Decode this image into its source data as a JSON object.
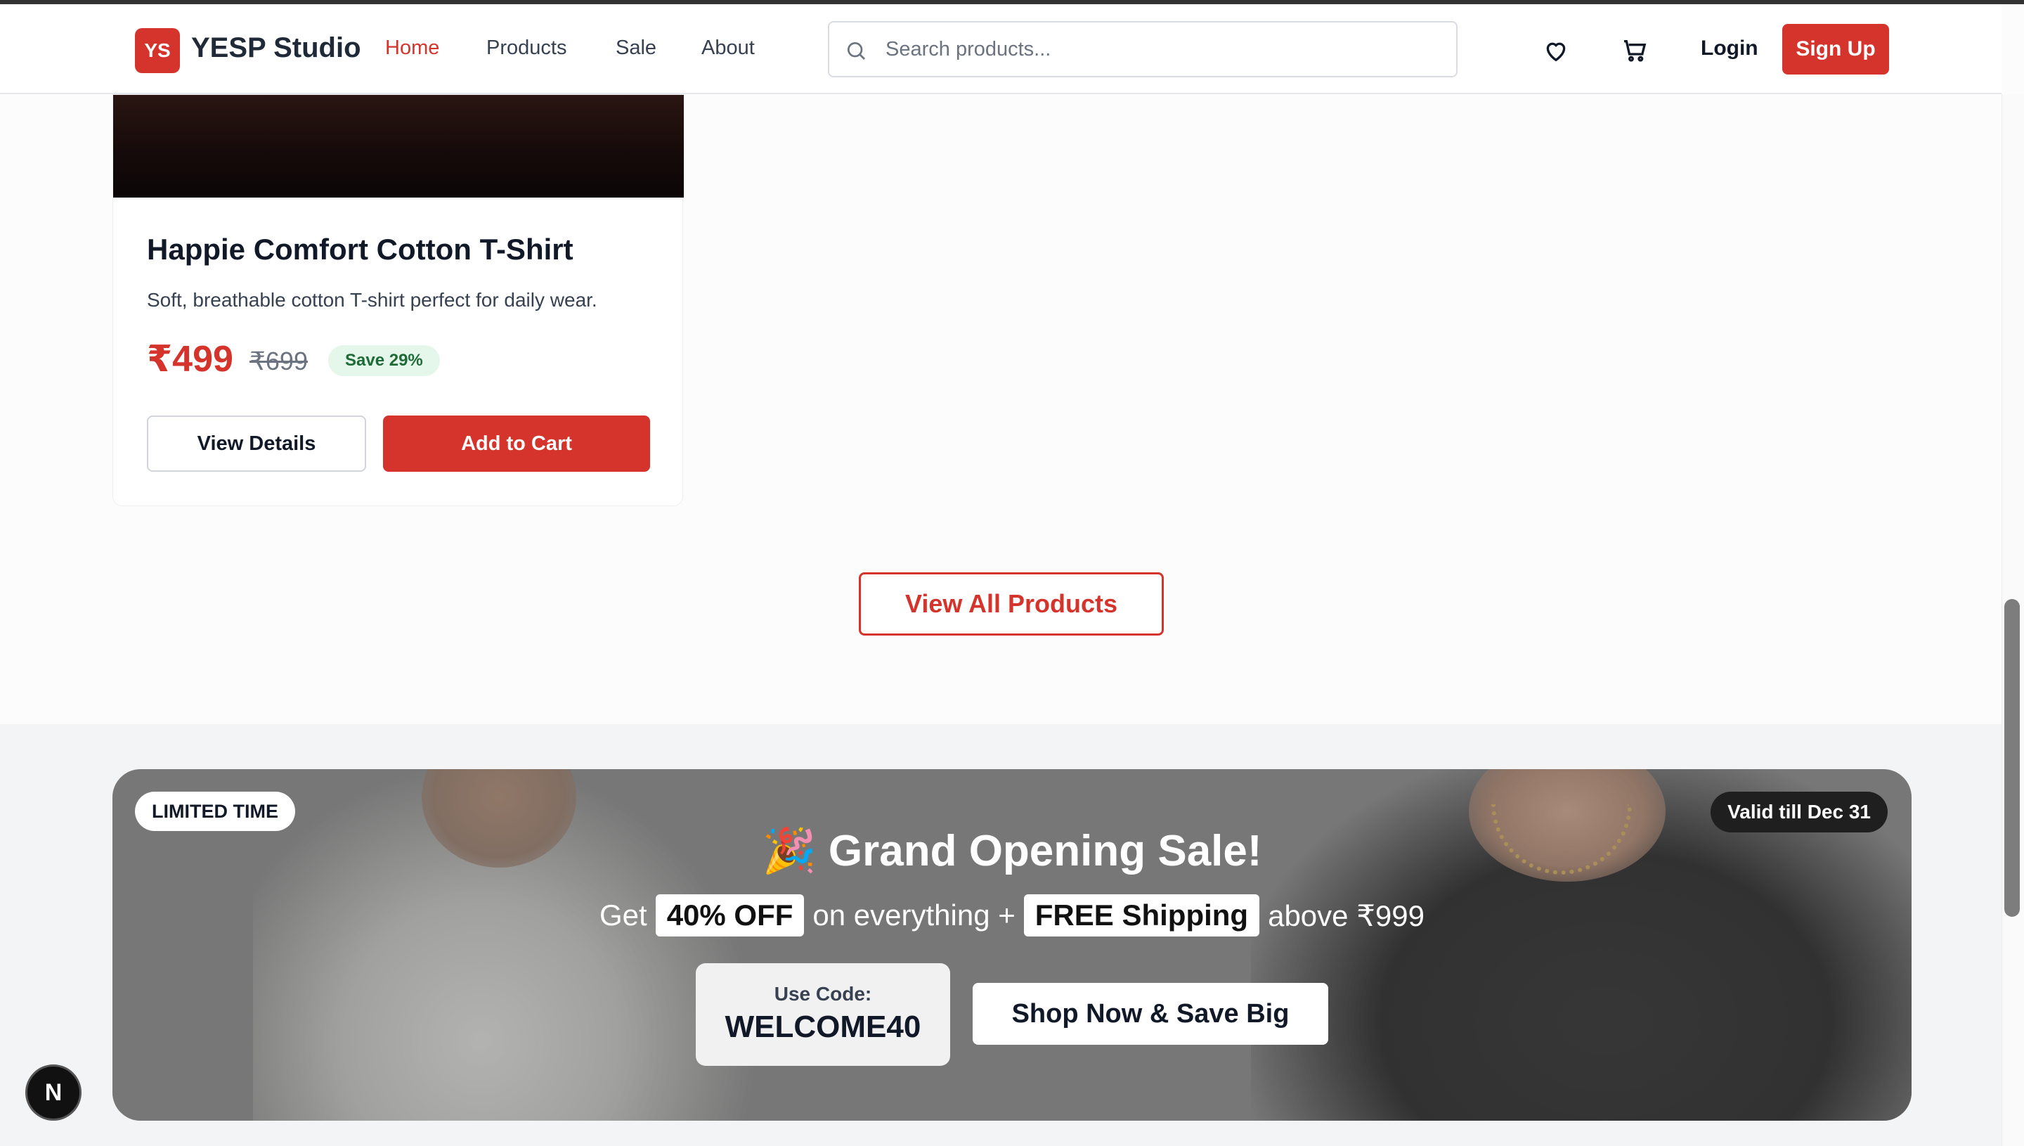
{
  "header": {
    "logo_text": "YS",
    "brand": "YESP Studio",
    "nav": [
      {
        "label": "Home",
        "active": true
      },
      {
        "label": "Products",
        "active": false
      },
      {
        "label": "Sale",
        "active": false
      },
      {
        "label": "About",
        "active": false
      }
    ],
    "search_placeholder": "Search products...",
    "login": "Login",
    "signup": "Sign Up"
  },
  "product": {
    "title": "Happie Comfort Cotton T-Shirt",
    "description": "Soft, breathable cotton T-shirt perfect for daily wear.",
    "price": "₹499",
    "original_price": "₹699",
    "save_badge": "Save 29%",
    "view_details": "View Details",
    "add_to_cart": "Add to Cart"
  },
  "view_all": "View All Products",
  "promo": {
    "badge_left": "LIMITED TIME",
    "badge_right": "Valid till Dec 31",
    "title": "🎉 Grand Opening Sale!",
    "line_get": "Get",
    "discount": "40% OFF",
    "line_mid": "on everything +",
    "shipping": "FREE Shipping",
    "line_end": "above ₹999",
    "code_label": "Use Code:",
    "code": "WELCOME40",
    "cta": "Shop Now & Save Big"
  },
  "dev_badge": "N",
  "colors": {
    "accent": "#d4342c",
    "save_bg": "#e4f7ea",
    "save_text": "#1f6b37"
  }
}
